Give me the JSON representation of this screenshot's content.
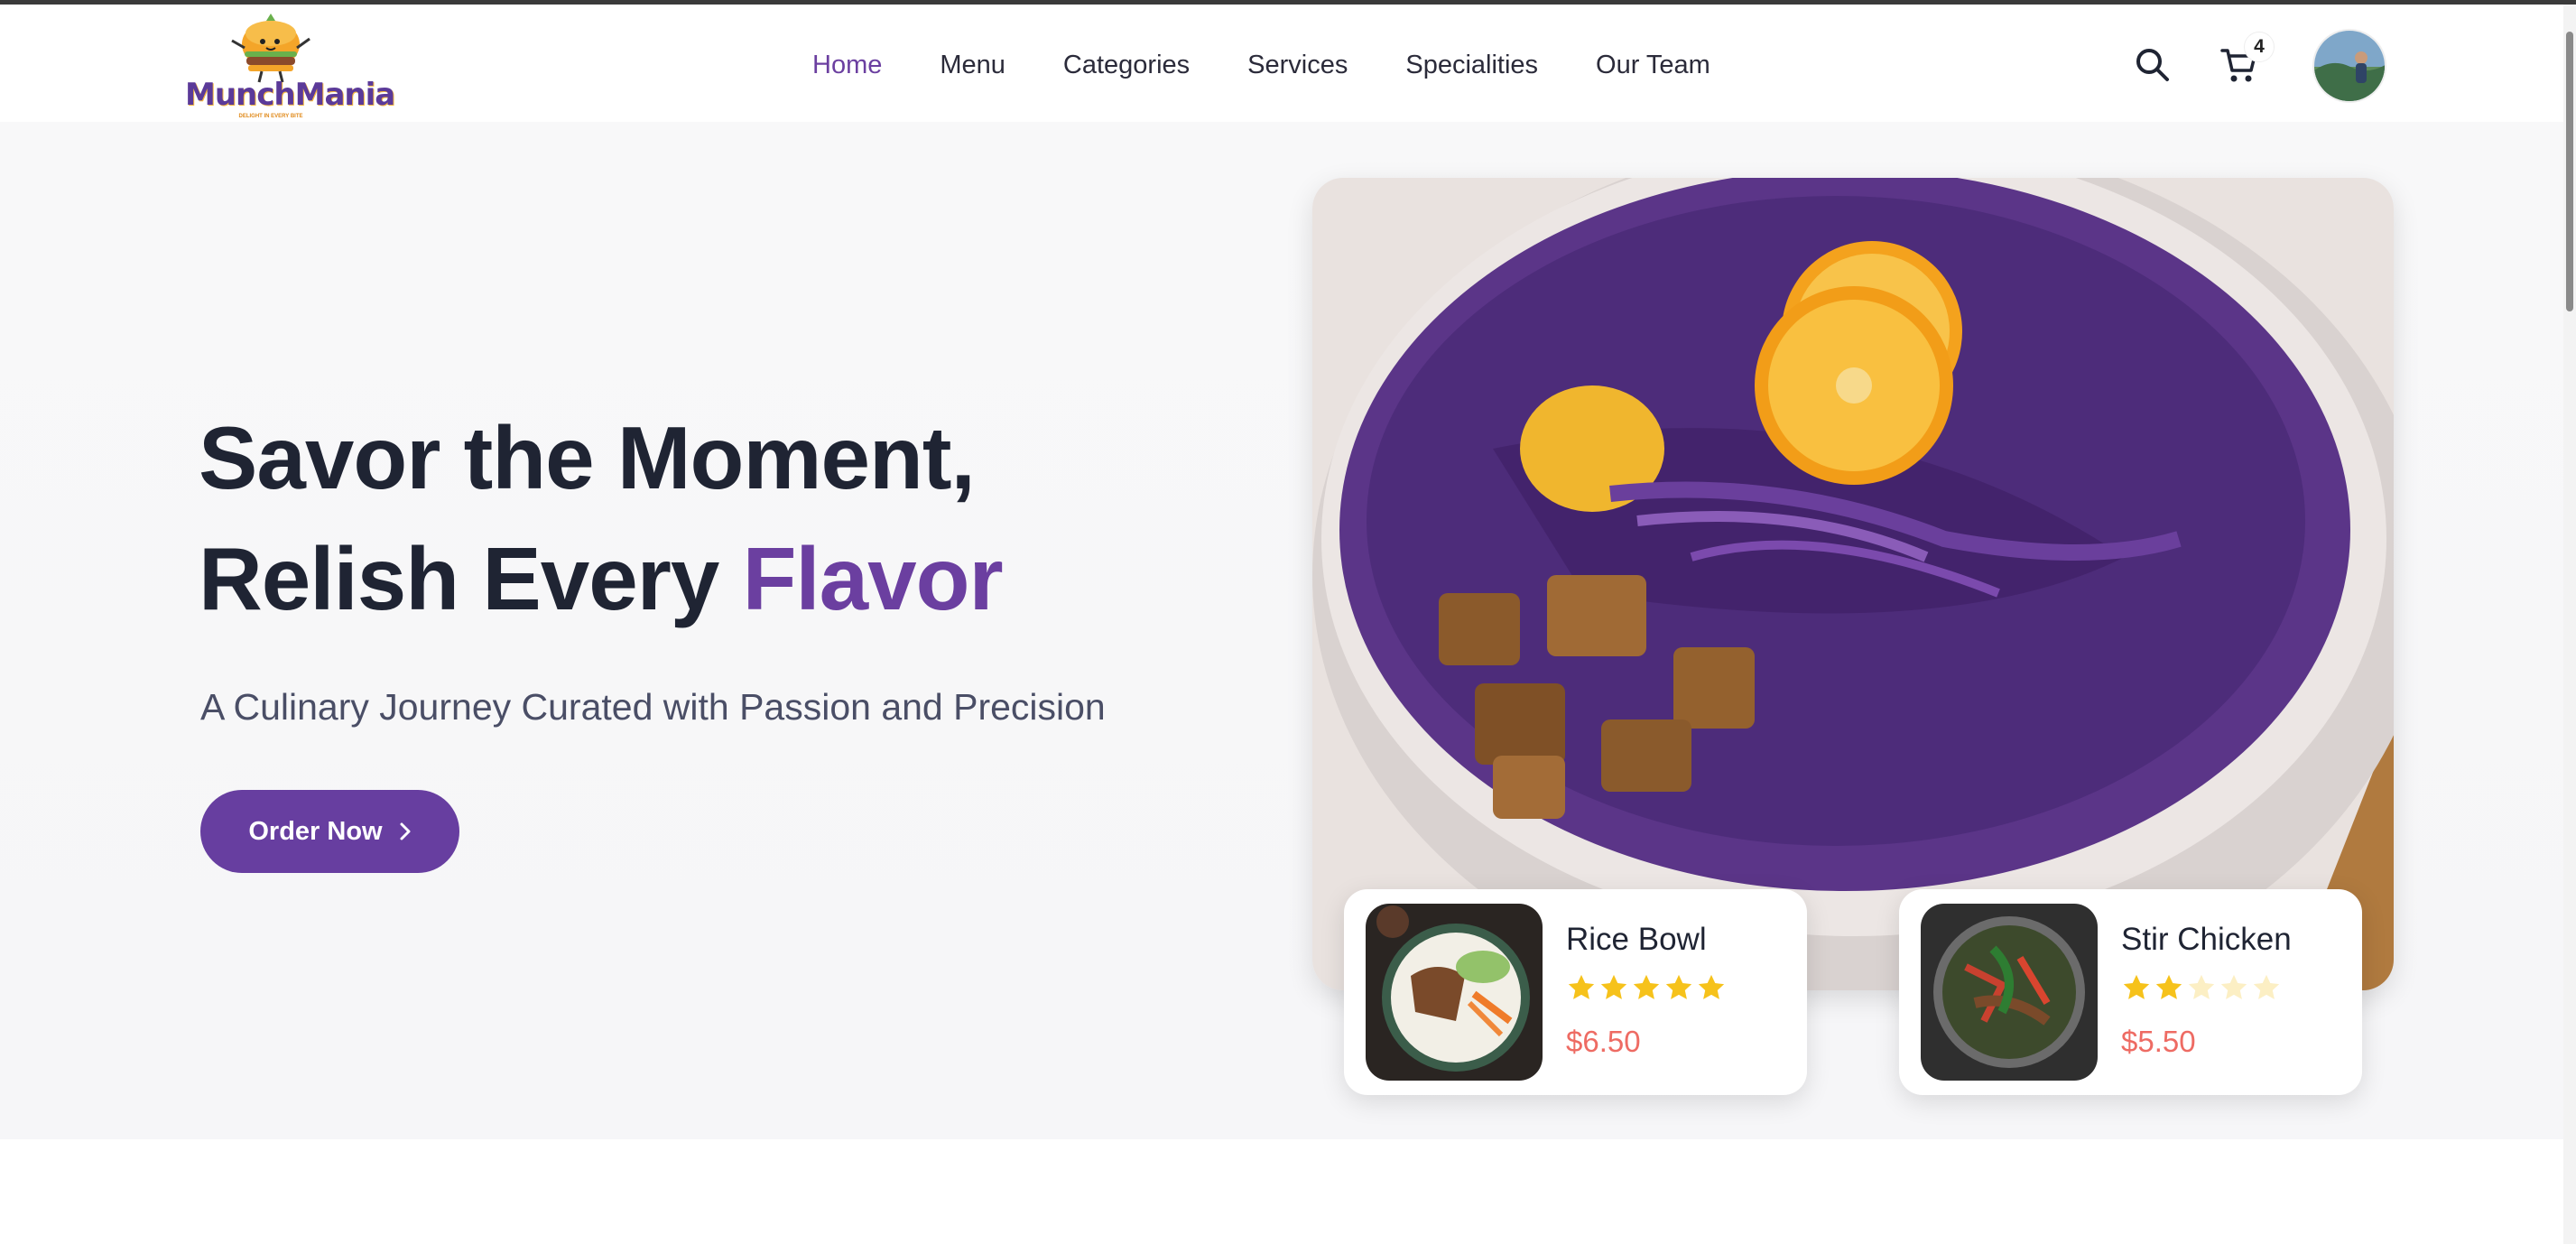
{
  "brand": {
    "name": "MunchMania",
    "tagline": "DELIGHT IN EVERY BITE",
    "accent_color": "#6b3fa0",
    "price_color": "#ee6b63",
    "star_color": "#f6c21b"
  },
  "nav": {
    "items": [
      {
        "label": "Home",
        "active": true
      },
      {
        "label": "Menu",
        "active": false
      },
      {
        "label": "Categories",
        "active": false
      },
      {
        "label": "Services",
        "active": false
      },
      {
        "label": "Specialities",
        "active": false
      },
      {
        "label": "Our Team",
        "active": false
      }
    ]
  },
  "header": {
    "search_icon": "search-icon",
    "cart_icon": "cart-icon",
    "cart_count": "4",
    "avatar": "user-avatar"
  },
  "hero": {
    "title_line1": "Savor the Moment,",
    "title_line2_prefix": "Relish Every ",
    "title_line2_accent": "Flavor",
    "subtitle": "A Culinary Journey Curated with Passion and Precision",
    "cta_label": "Order Now",
    "cta_icon": "chevron-right-icon",
    "image": "purple-cabbage-soup-bowl"
  },
  "featured": [
    {
      "name": "Rice Bowl",
      "rating": 5,
      "max_rating": 5,
      "price": "$6.50",
      "image": "rice-bowl-photo"
    },
    {
      "name": "Stir Chicken",
      "rating": 2,
      "max_rating": 5,
      "price": "$5.50",
      "image": "stir-chicken-photo"
    }
  ]
}
